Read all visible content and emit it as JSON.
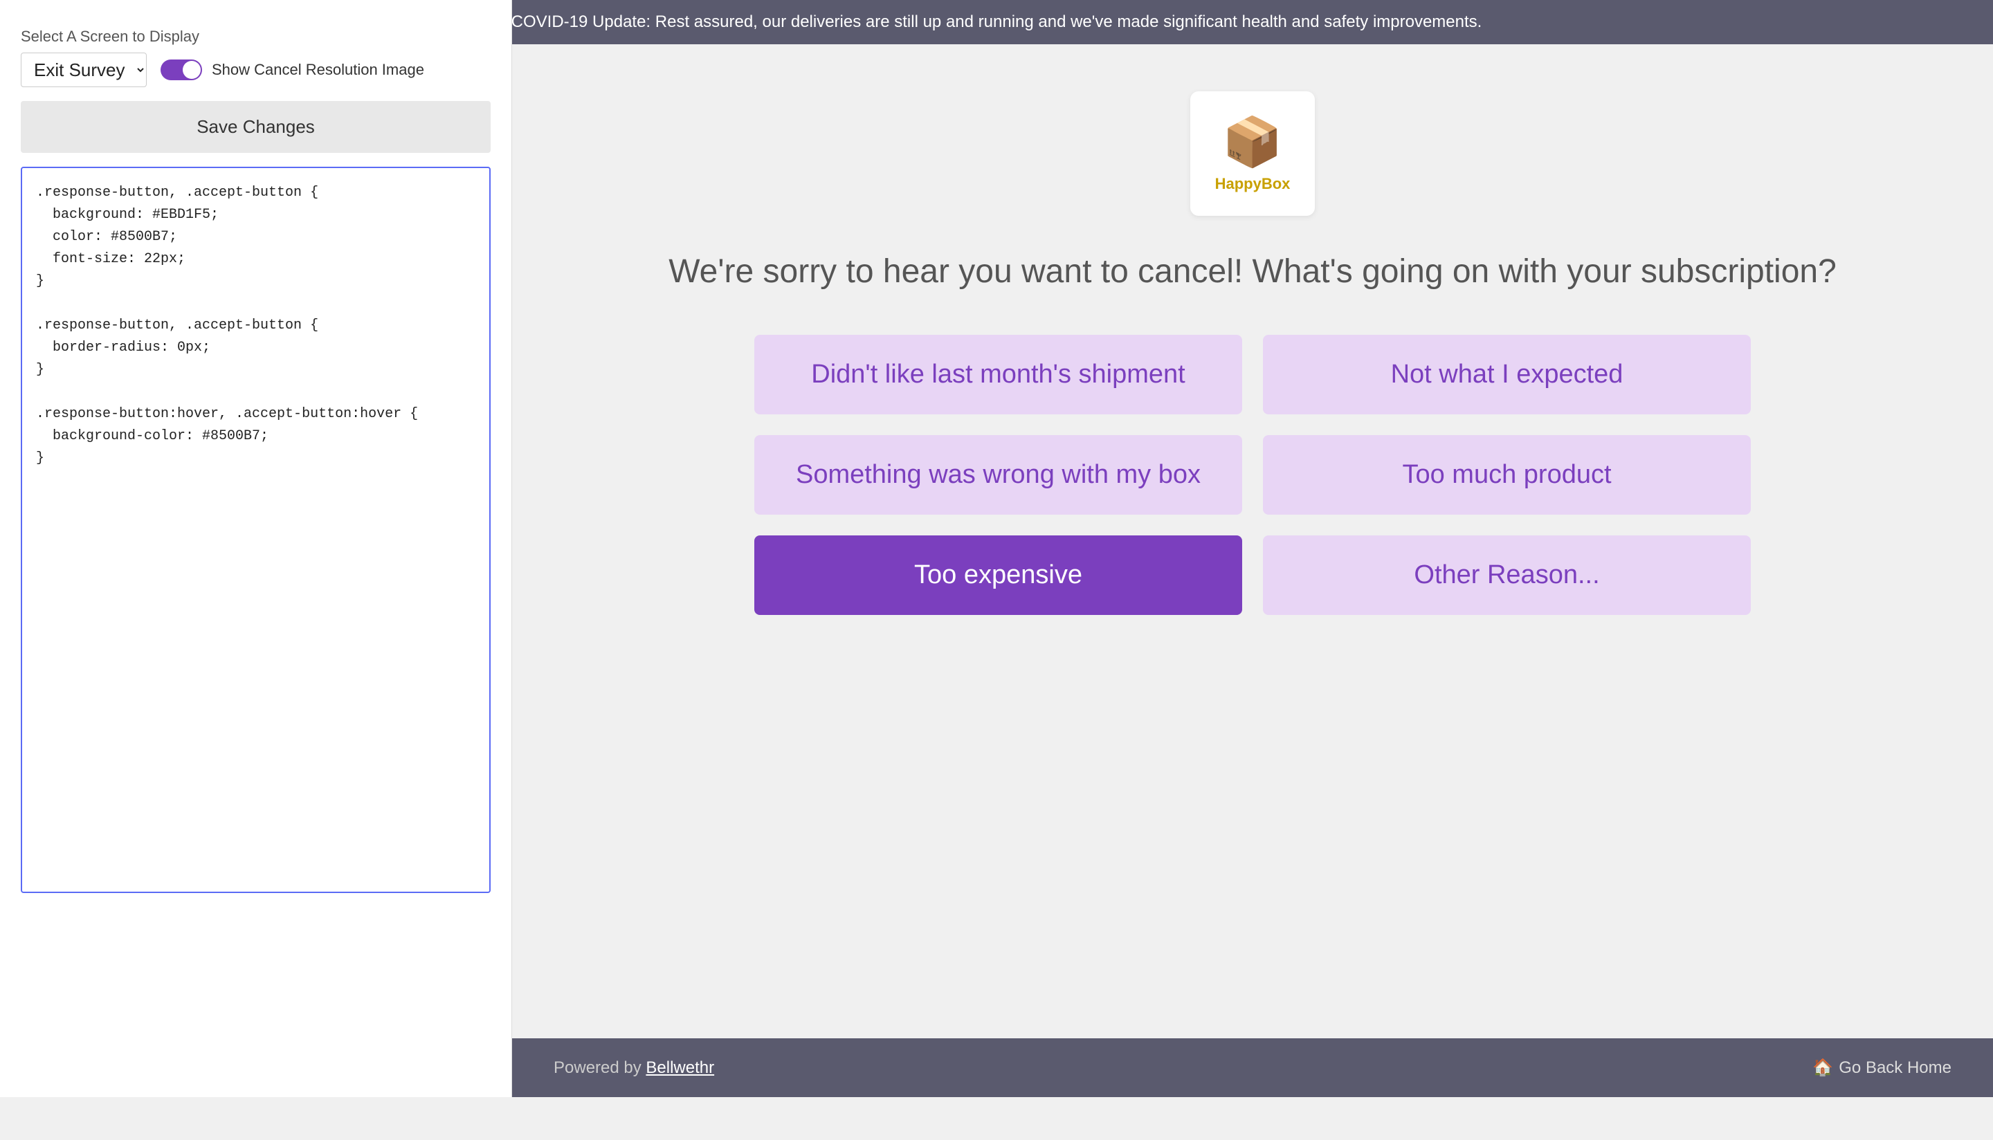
{
  "covid_banner": {
    "text": "COVID-19 Update: Rest assured, our deliveries are still up and running and we've made significant health and safety improvements."
  },
  "left_panel": {
    "select_label": "Select A Screen to Display",
    "screen_select_value": "Exit Survey",
    "screen_select_options": [
      "Exit Survey"
    ],
    "toggle_label": "Show Cancel Resolution Image",
    "toggle_on": true,
    "save_button": "Save Changes",
    "code_content": ".response-button, .accept-button {\n  background: #EBD1F5;\n  color: #8500B7;\n  font-size: 22px;\n}\n\n.response-button, .accept-button {\n  border-radius: 0px;\n}\n\n.response-button:hover, .accept-button:hover {\n  background-color: #8500B7;\n}"
  },
  "survey": {
    "brand_name": "HappyBox",
    "brand_icon": "📦",
    "question": "We're sorry to hear you want to cancel! What's going on with your subscription?",
    "reasons": [
      {
        "id": "r1",
        "label": "Didn't like last month's shipment",
        "style": "light-purple"
      },
      {
        "id": "r2",
        "label": "Not what I expected",
        "style": "light-purple"
      },
      {
        "id": "r3",
        "label": "Something was wrong with my box",
        "style": "light-purple"
      },
      {
        "id": "r4",
        "label": "Too much product",
        "style": "light-purple"
      },
      {
        "id": "r5",
        "label": "Too expensive",
        "style": "dark-purple"
      },
      {
        "id": "r6",
        "label": "Other Reason...",
        "style": "light-purple"
      }
    ]
  },
  "footer": {
    "powered_by_text": "Powered by ",
    "powered_by_link": "Bellwethr",
    "go_home_icon": "🏠",
    "go_home_text": "Go Back Home"
  }
}
